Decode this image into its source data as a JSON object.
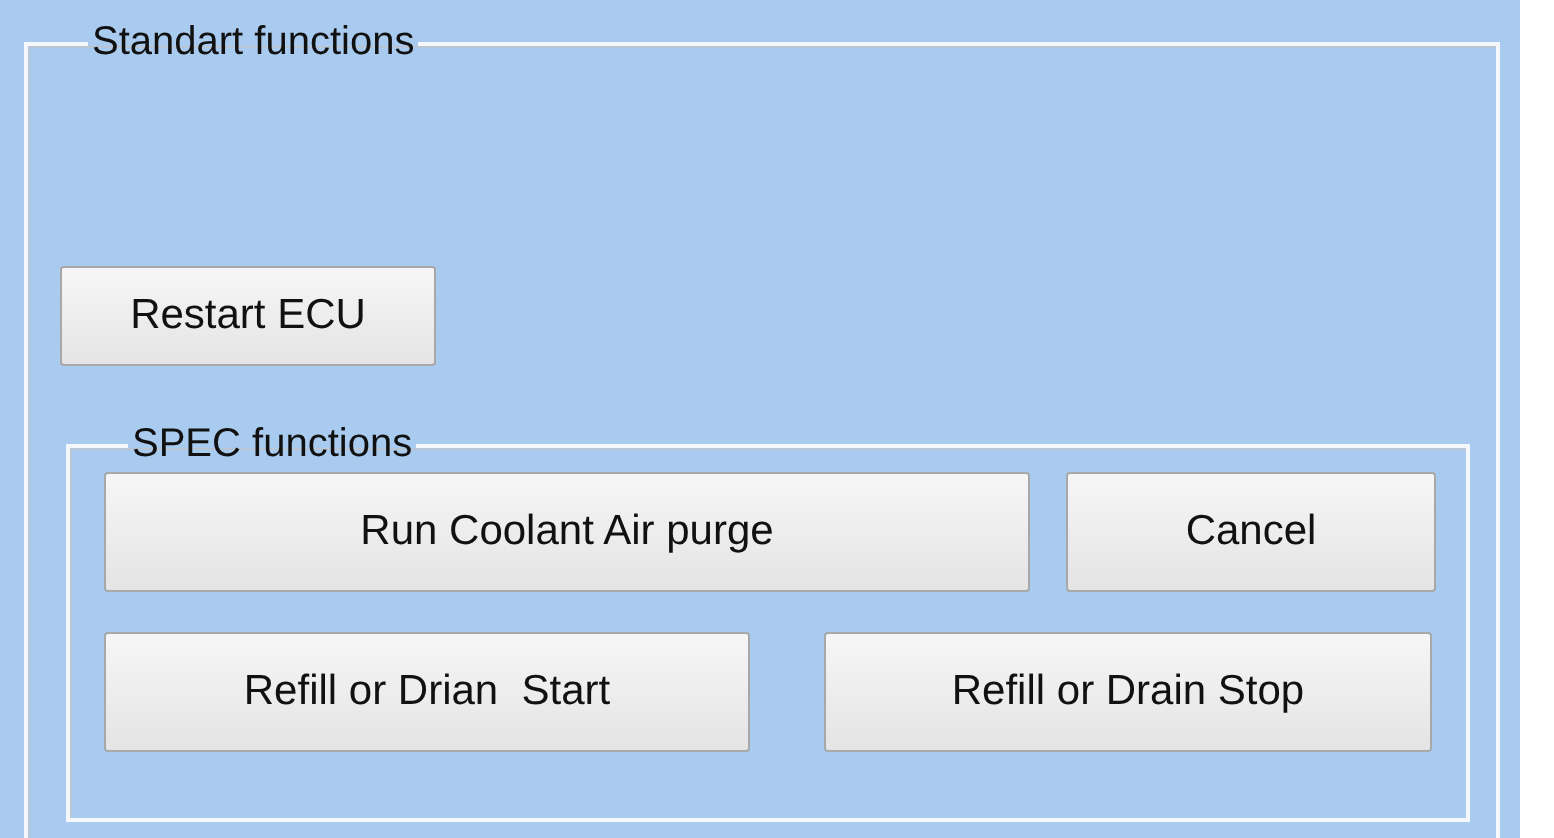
{
  "standard_group": {
    "title": "Standart functions",
    "buttons": [
      {
        "label": "Restart ECU"
      }
    ]
  },
  "spec_group": {
    "title": "SPEC functions",
    "rows": [
      {
        "buttons": [
          {
            "label": "Run Coolant Air purge"
          },
          {
            "label": "Cancel"
          }
        ]
      },
      {
        "buttons": [
          {
            "label": "Refill or Drian  Start"
          },
          {
            "label": "Refill or Drain Stop"
          }
        ]
      }
    ]
  }
}
